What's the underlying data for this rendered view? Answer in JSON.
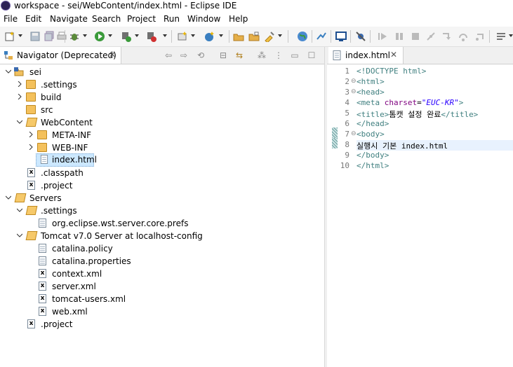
{
  "window": {
    "title": "workspace - sei/WebContent/index.html - Eclipse IDE"
  },
  "menu": [
    "File",
    "Edit",
    "Navigate",
    "Search",
    "Project",
    "Run",
    "Window",
    "Help"
  ],
  "colors": {
    "selection": "#cce8ff",
    "folder": "#f4c15c",
    "tag": "#3f7f7f",
    "attr": "#7f007f",
    "value": "#2a00ff"
  },
  "navigator": {
    "tab_label": "Navigator (Deprecated)",
    "tree": [
      {
        "label": "sei",
        "icon": "project-icon",
        "expanded": true
      },
      {
        "label": ".settings",
        "icon": "folder-icon",
        "expanded": false
      },
      {
        "label": "build",
        "icon": "folder-icon",
        "expanded": false
      },
      {
        "label": "src",
        "icon": "folder-icon"
      },
      {
        "label": "WebContent",
        "icon": "folder-open-icon",
        "expanded": true
      },
      {
        "label": "META-INF",
        "icon": "folder-icon",
        "expanded": false
      },
      {
        "label": "WEB-INF",
        "icon": "folder-icon",
        "expanded": false
      },
      {
        "label": "index.html",
        "icon": "html-file-icon",
        "selected": true
      },
      {
        "label": ".classpath",
        "icon": "xml-file-icon"
      },
      {
        "label": ".project",
        "icon": "xml-file-icon"
      },
      {
        "label": "Servers",
        "icon": "folder-open-icon",
        "expanded": true
      },
      {
        "label": ".settings",
        "icon": "folder-open-icon",
        "expanded": true
      },
      {
        "label": "org.eclipse.wst.server.core.prefs",
        "icon": "text-file-icon"
      },
      {
        "label": "Tomcat v7.0 Server at localhost-config",
        "icon": "folder-open-icon",
        "expanded": true
      },
      {
        "label": "catalina.policy",
        "icon": "text-file-icon"
      },
      {
        "label": "catalina.properties",
        "icon": "text-file-icon"
      },
      {
        "label": "context.xml",
        "icon": "xml-file-icon"
      },
      {
        "label": "server.xml",
        "icon": "xml-file-icon"
      },
      {
        "label": "tomcat-users.xml",
        "icon": "xml-file-icon"
      },
      {
        "label": "web.xml",
        "icon": "xml-file-icon"
      },
      {
        "label": ".project",
        "icon": "xml-file-icon"
      }
    ]
  },
  "editor": {
    "tab_label": "index.html",
    "line_numbers": [
      "1",
      "2",
      "3",
      "4",
      "5",
      "6",
      "7",
      "8",
      "9",
      "10"
    ],
    "lines": [
      "<!DOCTYPE html>",
      "<html>",
      "<head>",
      "<meta charset=\"EUC-KR\">",
      "<title>톰캣 설정 완료</title>",
      "</head>",
      "<body>",
      "실행시 기본 index.html",
      "</body>",
      "</html>"
    ],
    "code": {
      "l1": "<!DOCTYPE html>",
      "l2": "<html>",
      "l3": "<head>",
      "l4_tag": "<meta ",
      "l4_attr": "charset",
      "l4_eq": "=",
      "l4_val": "\"EUC-KR\"",
      "l4_end": ">",
      "l5_open": "<title>",
      "l5_text": "톰캣 설정 완료",
      "l5_close": "</title>",
      "l6": "</head>",
      "l7": "<body>",
      "l8": "실행시 기본 index.html",
      "l9": "</body>",
      "l10": "</html>"
    }
  }
}
